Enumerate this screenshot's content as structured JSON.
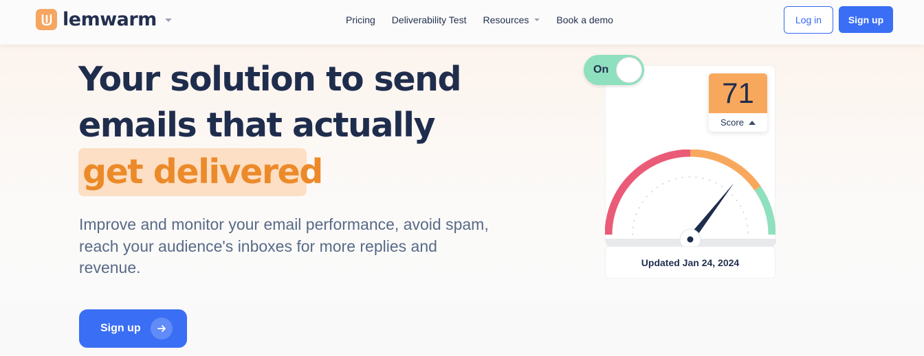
{
  "header": {
    "logo_text": "lemwarm",
    "nav": [
      {
        "label": "Pricing"
      },
      {
        "label": "Deliverability Test"
      },
      {
        "label": "Resources"
      },
      {
        "label": "Book a demo"
      }
    ],
    "login_label": "Log in",
    "signup_label": "Sign up"
  },
  "hero": {
    "title": "Your solution to send emails that actually",
    "highlight": "get delivered",
    "subtitle": "Improve and monitor your email performance, avoid spam, reach your audience's inboxes for more replies and revenue.",
    "cta_label": "Sign up"
  },
  "score_card": {
    "toggle_label": "On",
    "score_value": "71",
    "score_label": "Score",
    "updated_text": "Updated Jan 24, 2024",
    "score_fraction": 0.71
  },
  "colors": {
    "brand_blue": "#3a6ef5",
    "accent_orange": "#ec8a2a",
    "gauge_red": "#ea5b77",
    "gauge_orange": "#f8a85d",
    "gauge_green": "#8fe0be",
    "text_dark": "#1f2d4d"
  },
  "icons": [
    "lemwarm-logo-icon",
    "chevron-down-icon",
    "arrow-right-icon",
    "triangle-up-icon"
  ]
}
